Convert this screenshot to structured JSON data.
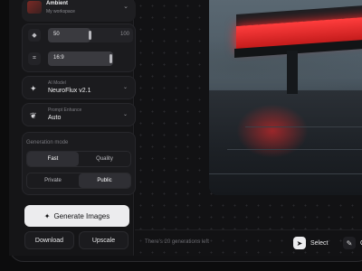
{
  "workspace": {
    "name": "Ambient",
    "subtitle": "My workspace"
  },
  "params": {
    "steps": {
      "value": "50",
      "max": "100",
      "fraction": 0.5
    },
    "aspect": {
      "value": "16:9"
    }
  },
  "model": {
    "label": "AI Model",
    "value": "NeuroFlux v2.1"
  },
  "enhance": {
    "label": "Prompt Enhance",
    "value": "Auto"
  },
  "mode": {
    "title": "Generation mode",
    "speed": [
      "Fast",
      "Quality"
    ],
    "speed_selected": "Fast",
    "visibility": [
      "Private",
      "Public"
    ],
    "visibility_selected": "Public"
  },
  "actions": {
    "generate": "Generate Images",
    "download": "Download",
    "upscale": "Upscale"
  },
  "footer": {
    "generations_left": "There's 20 generations left",
    "select": "Select",
    "next_tool": "C"
  },
  "colors": {
    "accent": "#ececee",
    "glow": "#ff3d3d",
    "background": "#0c0c0d"
  }
}
